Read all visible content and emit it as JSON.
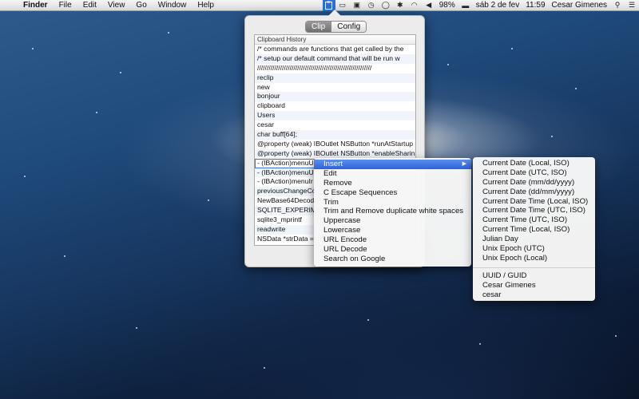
{
  "menubar": {
    "apple": "",
    "items": [
      "Finder",
      "File",
      "Edit",
      "View",
      "Go",
      "Window",
      "Help"
    ],
    "status": {
      "battery": "98%",
      "date": "sáb 2 de fev",
      "time": "11:59",
      "user": "Cesar Gimenes"
    }
  },
  "popover": {
    "tabs": [
      "Clip",
      "Config"
    ],
    "active_tab": "Clip",
    "history_header": "Clipboard History",
    "history": [
      "/* commands are functions that get called by the",
      "  /* setup our default command that will be run w",
      "    ////////////////////////////////////////////////////////////",
      "reclip",
      "new",
      "bonjour",
      "clipboard",
      "Users",
      "cesar",
      "  char buff[64];",
      "@property (weak) IBOutlet NSButton *runAtStartup",
      "@property (weak) IBOutlet NSButton *enableSharin",
      "- (IBAction)menuU",
      "- (IBAction)menuU",
      "- (IBAction)menuIr",
      "previousChangeCo",
      "NewBase64Decode",
      "SQLITE_EXPERIMEN",
      "sqlite3_mprintf",
      "readwrite",
      "NSData *strData ="
    ]
  },
  "context_menu": {
    "items": [
      "Insert",
      "Edit",
      "Remove",
      "C Escape Sequences",
      "Trim",
      "Trim and Remove duplicate white spaces",
      "Uppercase",
      "Lowercase",
      "URL Encode",
      "URL Decode",
      "Search on Google"
    ],
    "submenu_arrow": "▶"
  },
  "insert_submenu": {
    "items": [
      "Current Date (Local, ISO)",
      "Current Date (UTC, ISO)",
      "Current Date (mm/dd/yyyy)",
      "Current Date (dd/mm/yyyy)",
      "Current Date Time (Local, ISO)",
      "Current Date Time (UTC, ISO)",
      "Current Time (UTC, ISO)",
      "Current Time (Local, ISO)",
      "Julian Day",
      "Unix Epoch (UTC)",
      "Unix Epoch (Local)"
    ],
    "extra_items": [
      "UUID / GUID",
      "Cesar Gimenes",
      "cesar"
    ]
  }
}
